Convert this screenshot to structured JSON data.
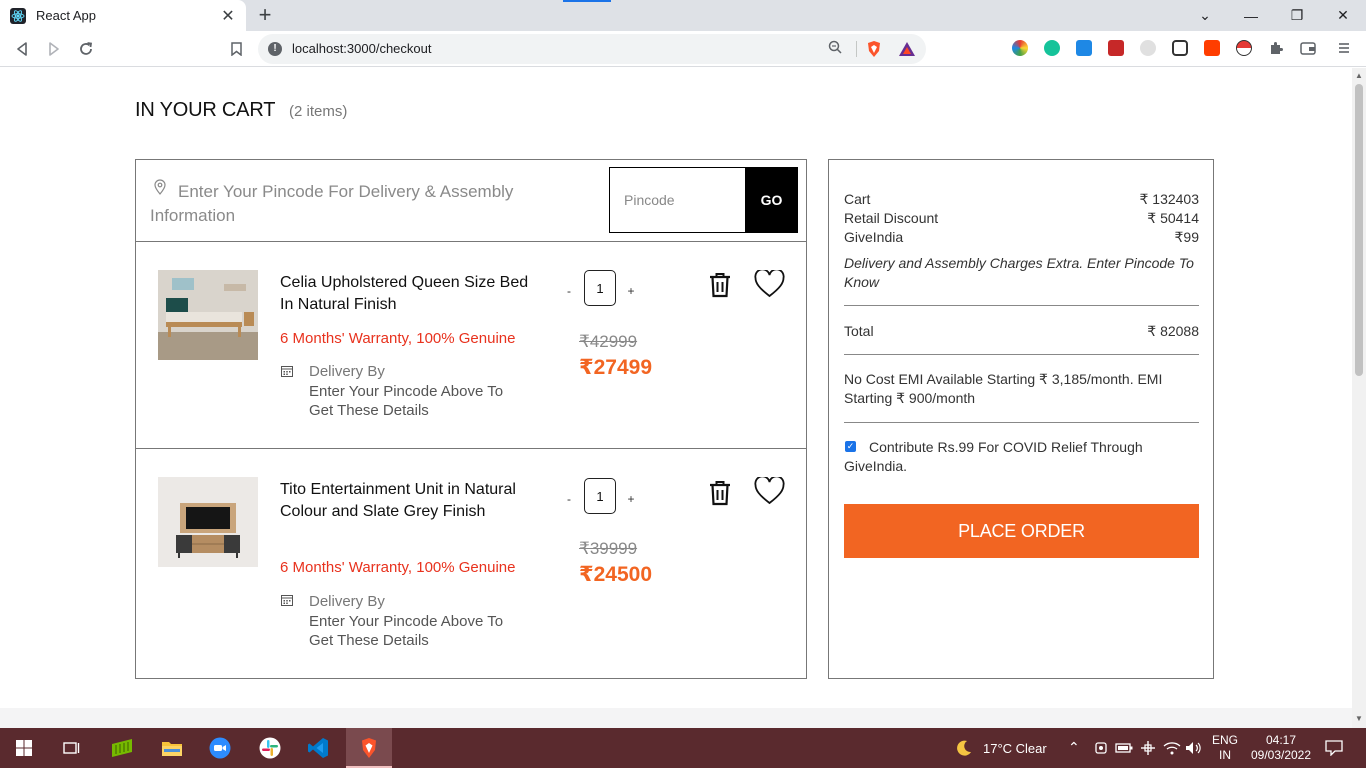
{
  "browser": {
    "tab_title": "React App",
    "tab_close": "✕",
    "new_tab": "+",
    "url": "localhost:3000/checkout",
    "win_minimize": "—",
    "win_restore": "❐",
    "win_close": "✕",
    "tab_list": "⌄"
  },
  "page": {
    "title": "IN YOUR CART",
    "item_count": "(2 items)"
  },
  "pincode": {
    "prompt": "Enter Your Pincode For Delivery & Assembly Information",
    "placeholder": "Pincode",
    "go_label": "GO"
  },
  "items": [
    {
      "name": "Celia Upholstered Queen Size Bed In Natural Finish",
      "warranty": "6 Months' Warranty, 100% Genuine",
      "delivery_label": "Delivery By",
      "delivery_info": "Enter Your Pincode Above To Get These Details",
      "qty": "1",
      "minus": "-",
      "plus": "+",
      "price_old": "₹42999",
      "price_new": "₹27499"
    },
    {
      "name": "Tito Entertainment Unit in Natural Colour and Slate Grey Finish",
      "warranty": "6 Months' Warranty, 100% Genuine",
      "delivery_label": "Delivery By",
      "delivery_info": "Enter Your Pincode Above To Get These Details",
      "qty": "1",
      "minus": "-",
      "plus": "+",
      "price_old": "₹39999",
      "price_new": "₹24500"
    }
  ],
  "summary": {
    "cart_label": "Cart",
    "cart_value": "₹ 132403",
    "discount_label": "Retail Discount",
    "discount_value": "₹ 50414",
    "giveindia_label": "GiveIndia",
    "giveindia_value": "₹99",
    "delivery_note": "Delivery and Assembly Charges Extra. Enter Pincode To Know",
    "total_label": "Total",
    "total_value": "₹ 82088",
    "emi_text": "No Cost EMI Available Starting ₹ 3,185/month. EMI Starting ₹ 900/month",
    "contribute_text": "Contribute Rs.99 For COVID Relief Through GiveIndia.",
    "contribute_checked": true,
    "place_order": "PLACE ORDER"
  },
  "taskbar": {
    "weather": "17°C  Clear",
    "lang_line1": "ENG",
    "lang_line2": "IN",
    "time": "04:17",
    "date": "09/03/2022"
  },
  "colors": {
    "accent": "#f26522",
    "warranty": "#e8321e",
    "taskbar": "#5a2a2e"
  }
}
